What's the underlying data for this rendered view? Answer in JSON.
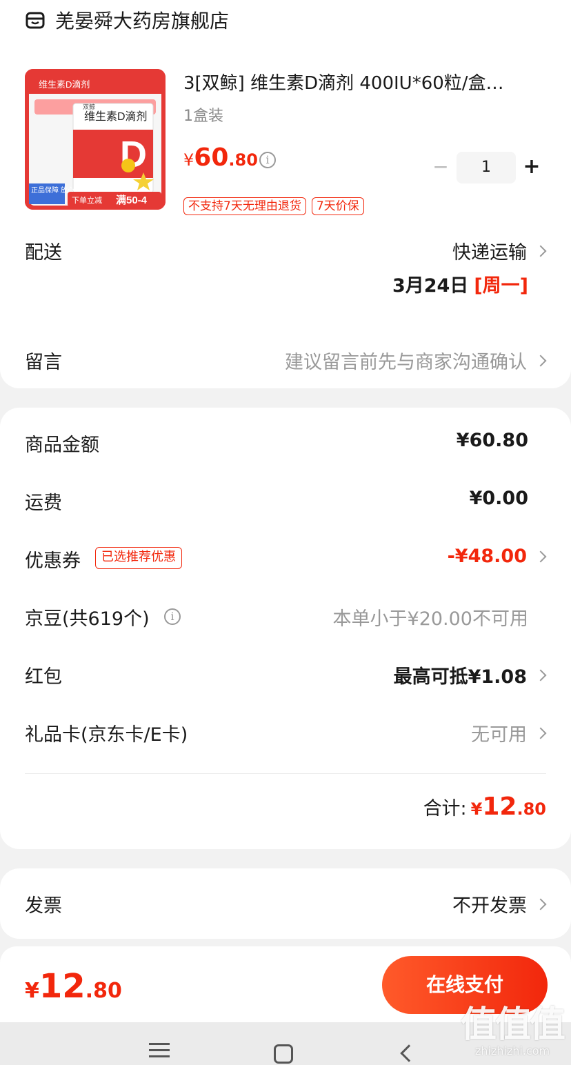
{
  "store": {
    "name": "羌晏舜大药房旗舰店"
  },
  "product": {
    "title": "3[双鲸] 维生素D滴剂 400IU*60粒/盒…",
    "spec": "1盒装",
    "price": {
      "symbol": "¥",
      "integer": "60",
      "decimal": ".80"
    },
    "quantity": "1",
    "stepper": {
      "minus": "−",
      "plus": "+"
    },
    "tags": [
      "不支持7天无理由退货",
      "7天价保"
    ],
    "image": {
      "banner": "维生素D滴剂",
      "box_title": "维生素D滴剂",
      "box_brand": "双鲸",
      "letter": "D",
      "guarantee": "正品保障 放心买药",
      "promo_prefix": "下单立减",
      "promo": "满50-4"
    }
  },
  "delivery": {
    "label": "配送",
    "method": "快递运输",
    "date": "3月24日",
    "day": "[周一]"
  },
  "message": {
    "label": "留言",
    "placeholder": "建议留言前先与商家沟通确认"
  },
  "summary": {
    "goods": {
      "label": "商品金额",
      "value": "¥60.80"
    },
    "shipping": {
      "label": "运费",
      "value": "¥0.00"
    },
    "coupon": {
      "label": "优惠券",
      "tag": "已选推荐优惠",
      "value": "-¥48.00"
    },
    "beans": {
      "label": "京豆(共619个)",
      "value": "本单小于¥20.00不可用"
    },
    "red_packet": {
      "label": "红包",
      "value": "最高可抵¥1.08"
    },
    "gift_card": {
      "label": "礼品卡(京东卡/E卡)",
      "value": "无可用"
    },
    "total": {
      "label": "合计:",
      "symbol": "¥",
      "integer": "12",
      "decimal": ".80"
    }
  },
  "invoice": {
    "label": "发票",
    "value": "不开发票"
  },
  "pay_bar": {
    "amount": {
      "symbol": "¥",
      "integer": "12",
      "decimal": ".80"
    },
    "button": "在线支付"
  },
  "watermark": {
    "mark": "值值值",
    "url": "zhizhizhi.com"
  },
  "colors": {
    "accent": "#f2270c",
    "muted": "#999999",
    "background": "#f2f2f2"
  }
}
